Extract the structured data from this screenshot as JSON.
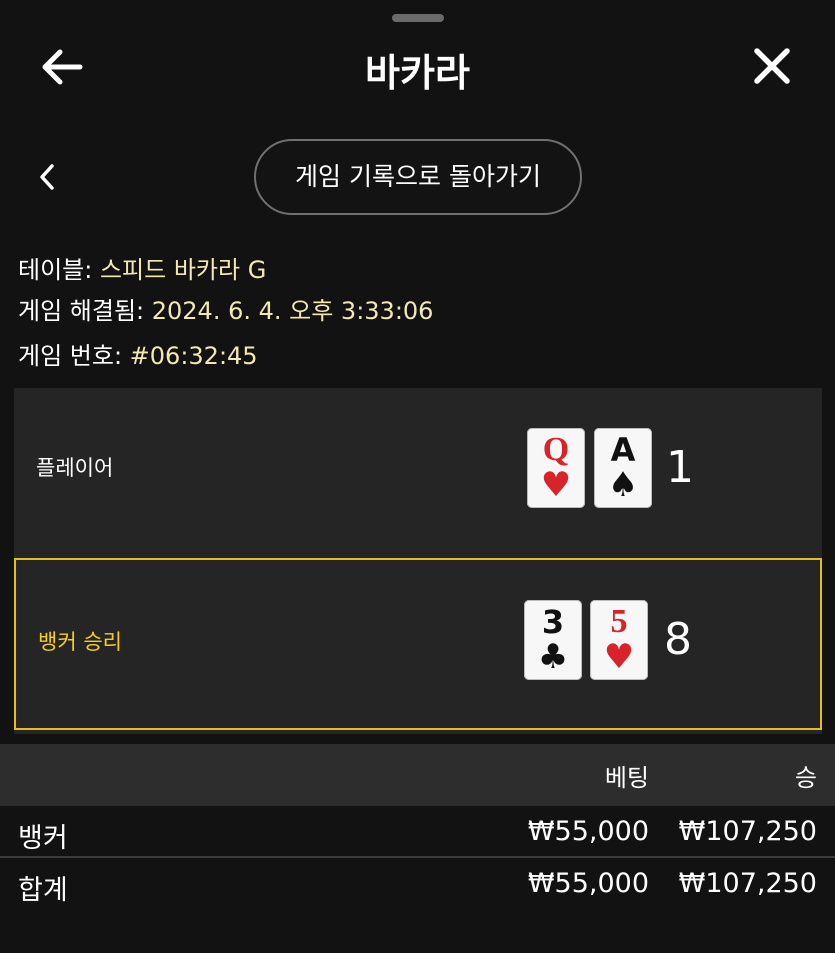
{
  "header": {
    "title": "바카라"
  },
  "history_button_label": "게임 기록으로 돌아가기",
  "info": {
    "table_label": "테이블: ",
    "table_value": "스피드 바카라 G",
    "resolved_label": "게임 해결됨: ",
    "resolved_value": "2024. 6. 4. 오후 3:33:06",
    "number_label": "게임 번호: ",
    "number_value": "#06:32:45"
  },
  "results": {
    "player": {
      "label": "플레이어",
      "cards": [
        {
          "rank": "Q",
          "suit": "♥",
          "color": "red"
        },
        {
          "rank": "A",
          "suit": "♠",
          "color": "black"
        }
      ],
      "score": "1"
    },
    "banker": {
      "label": "뱅커 승리",
      "highlight_color": "#e2bf20",
      "cards": [
        {
          "rank": "3",
          "suit": "♣",
          "color": "black"
        },
        {
          "rank": "5",
          "suit": "♥",
          "color": "red"
        }
      ],
      "score": "8"
    }
  },
  "bets": {
    "headers": {
      "bet": "베팅",
      "win": "승"
    },
    "rows": [
      {
        "name": "뱅커",
        "bet": "₩55,000",
        "win": "₩107,250"
      },
      {
        "name": "합계",
        "bet": "₩55,000",
        "win": "₩107,250"
      }
    ]
  },
  "icons": {
    "back": "arrow-left-icon",
    "close": "close-icon",
    "prev": "chevron-left-icon"
  }
}
